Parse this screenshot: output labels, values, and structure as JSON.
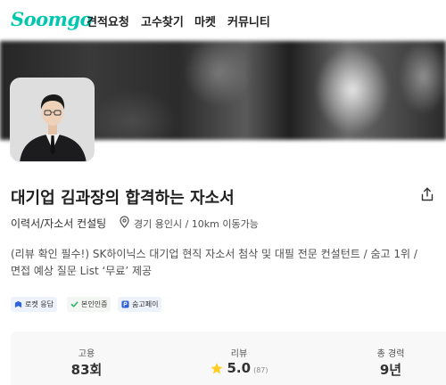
{
  "app": {
    "logo_text": "Soomgo"
  },
  "nav": {
    "items": [
      {
        "label": "견적요청"
      },
      {
        "label": "고수찾기"
      },
      {
        "label": "마켓"
      },
      {
        "label": "커뮤니티"
      }
    ]
  },
  "profile": {
    "title": "대기업 김과장의 합격하는 자소서",
    "category": "이력서/자소서 컨설팅",
    "location": "경기 용인시 / 10km 이동가능",
    "description_lines": [
      "(리뷰 확인 필수!) SK하이닉스 대기업 현직 자소서 첨삭 및 대필 전문 컨설턴트 / 숨고 1위 /",
      "면접 예상 질문 List ‘무료’ 제공"
    ],
    "badges": [
      {
        "label": "로켓 응답",
        "icon": "rocket-icon"
      },
      {
        "label": "본인인증",
        "icon": "check-icon"
      },
      {
        "label": "숨고페이",
        "icon": "pay-icon"
      }
    ]
  },
  "stats": {
    "hires": {
      "label": "고용",
      "value": "83회"
    },
    "reviews": {
      "label": "리뷰",
      "value": "5.0",
      "count": "(87)"
    },
    "experience": {
      "label": "총 경력",
      "value": "9년"
    }
  },
  "colors": {
    "brand": "#00c7ae",
    "star": "#ffce21",
    "badge_blue": "#2f62d8",
    "badge_green": "#19b35f"
  }
}
